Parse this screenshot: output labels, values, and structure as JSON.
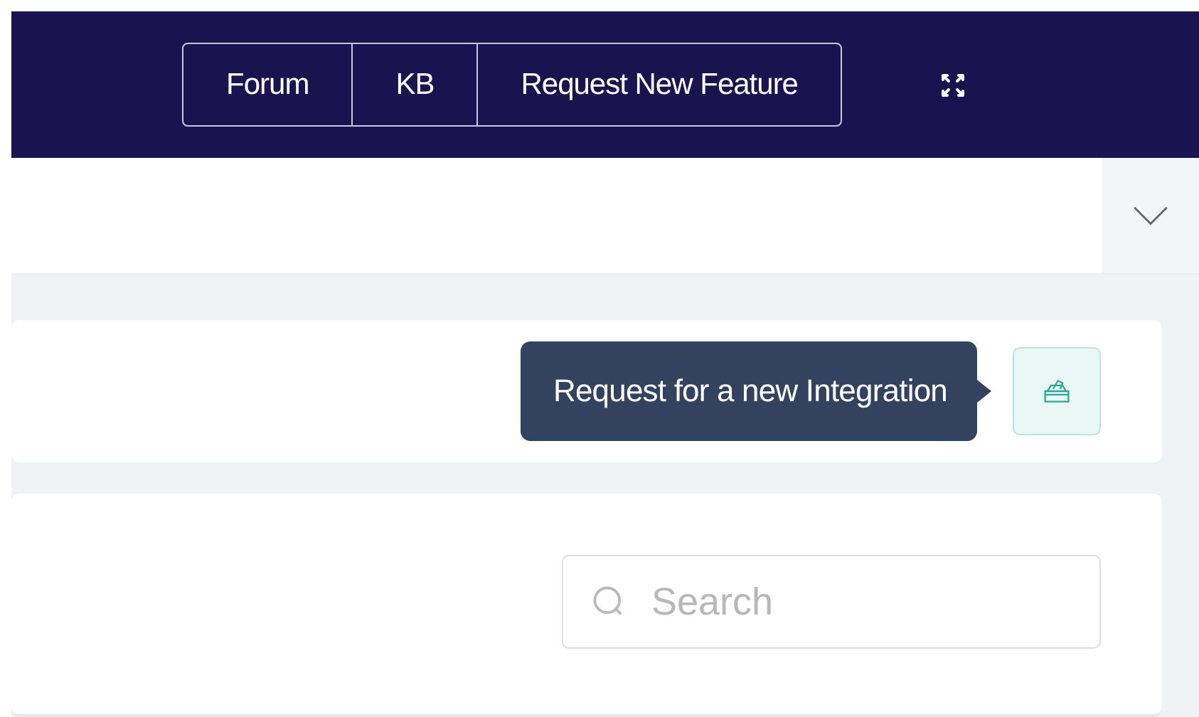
{
  "navbar": {
    "links": [
      "Forum",
      "KB",
      "Request New Feature"
    ]
  },
  "integration_card": {
    "tooltip": "Request for a new Integration"
  },
  "search": {
    "placeholder": "Search"
  }
}
